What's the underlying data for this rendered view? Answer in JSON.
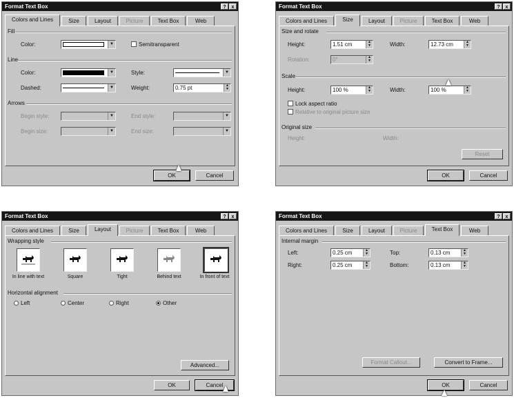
{
  "dialog_title": "Format Text Box",
  "title_buttons": [
    "?",
    "x"
  ],
  "tabs": [
    "Colors and Lines",
    "Size",
    "Layout",
    "Picture",
    "Text Box",
    "Web"
  ],
  "buttons": {
    "ok": "OK",
    "cancel": "Cancel"
  },
  "colors_lines": {
    "fill_group": "Fill",
    "fill_color_label": "Color:",
    "semitransparent_label": "Semitransparent",
    "line_group": "Line",
    "line_color_label": "Color:",
    "dashed_label": "Dashed:",
    "style_label": "Style:",
    "weight_label": "Weight:",
    "weight_value": "0.75 pt",
    "arrows_group": "Arrows",
    "begin_style_label": "Begin style:",
    "begin_size_label": "Begin size:",
    "end_style_label": "End style:",
    "end_size_label": "End size:",
    "fill_swatch": "#ffffff",
    "line_swatch": "#000000"
  },
  "size": {
    "size_rotate_group": "Size and rotate",
    "height_label": "Height:",
    "height_value": "1.51 cm",
    "width_label": "Width:",
    "width_value": "12.73 cm",
    "rotation_label": "Rotation:",
    "rotation_value": "0°",
    "scale_group": "Scale",
    "scale_height_label": "Height:",
    "scale_height_value": "100 %",
    "scale_width_label": "Width:",
    "scale_width_value": "100 %",
    "lock_aspect_label": "Lock aspect ratio",
    "relative_label": "Relative to original picture size",
    "original_group": "Original size",
    "original_height_label": "Height:",
    "original_width_label": "Width:",
    "reset_label": "Reset"
  },
  "layout": {
    "wrapping_group": "Wrapping style",
    "styles": [
      "In line with text",
      "Square",
      "Tight",
      "Behind text",
      "In front of text"
    ],
    "horizontal_group": "Horizontal alignment",
    "alignments": [
      "Left",
      "Center",
      "Right",
      "Other"
    ],
    "advanced_label": "Advanced..."
  },
  "textbox": {
    "margin_group": "Internal margin",
    "left_label": "Left:",
    "left_value": "0.25 cm",
    "top_label": "Top:",
    "top_value": "0.13 cm",
    "right_label": "Right:",
    "right_value": "0.25 cm",
    "bottom_label": "Bottom:",
    "bottom_value": "0.13 cm",
    "format_callout_label": "Format Callout...",
    "convert_frame_label": "Convert to Frame..."
  }
}
